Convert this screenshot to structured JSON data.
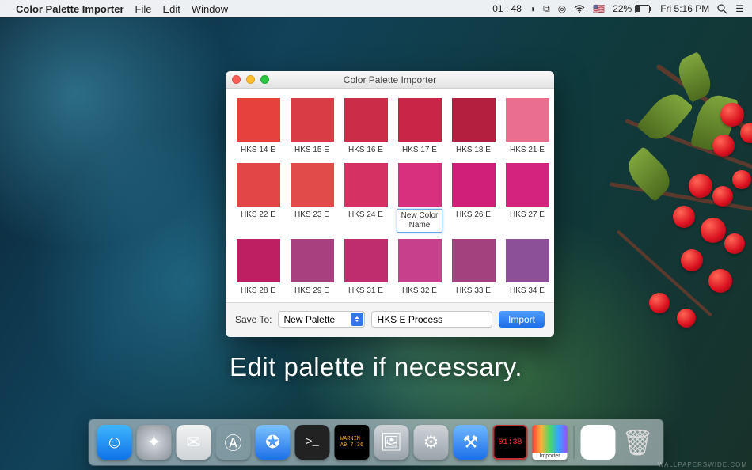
{
  "menubar": {
    "app_name": "Color Palette Importer",
    "items": [
      "File",
      "Edit",
      "Window"
    ],
    "clock_left": "01 : 48",
    "battery_pct": "22%",
    "clock_right": "Fri 5:16 PM"
  },
  "window": {
    "title": "Color Palette Importer",
    "swatches": [
      {
        "label": "HKS 14 E",
        "color": "#e7413d",
        "editing": false
      },
      {
        "label": "HKS 15 E",
        "color": "#d93c44",
        "editing": false
      },
      {
        "label": "HKS 16 E",
        "color": "#cb2c47",
        "editing": false
      },
      {
        "label": "HKS 17 E",
        "color": "#c92546",
        "editing": false
      },
      {
        "label": "HKS 18 E",
        "color": "#b41f3f",
        "editing": false
      },
      {
        "label": "HKS 21 E",
        "color": "#ea6f8e",
        "editing": false
      },
      {
        "label": "HKS 22 E",
        "color": "#e24646",
        "editing": false
      },
      {
        "label": "HKS 23 E",
        "color": "#e14b4a",
        "editing": false
      },
      {
        "label": "HKS 24 E",
        "color": "#d63163",
        "editing": false
      },
      {
        "label": "New Color Name",
        "color": "#d82f7e",
        "editing": true
      },
      {
        "label": "HKS 26 E",
        "color": "#cf1f79",
        "editing": false
      },
      {
        "label": "HKS 27 E",
        "color": "#d4237f",
        "editing": false
      },
      {
        "label": "HKS 28 E",
        "color": "#be1f62",
        "editing": false
      },
      {
        "label": "HKS 29 E",
        "color": "#a8407e",
        "editing": false
      },
      {
        "label": "HKS 31 E",
        "color": "#c02d6f",
        "editing": false
      },
      {
        "label": "HKS 32 E",
        "color": "#c7408b",
        "editing": false
      },
      {
        "label": "HKS 33 E",
        "color": "#a3417f",
        "editing": false
      },
      {
        "label": "HKS 34 E",
        "color": "#8c5099",
        "editing": false
      }
    ],
    "save_to_label": "Save To:",
    "save_to_value": "New Palette",
    "palette_name": "HKS E Process",
    "import_label": "Import"
  },
  "caption": "Edit palette if necessary.",
  "dock": {
    "items": [
      {
        "name": "finder",
        "bg": "linear-gradient(#3fb6ff,#1072e8)",
        "glyph": "☺"
      },
      {
        "name": "launchpad",
        "bg": "radial-gradient(circle,#d8dde2,#8a9198)",
        "glyph": "✦"
      },
      {
        "name": "mail",
        "bg": "linear-gradient(#f2f2f2,#cfd4d8)",
        "glyph": "✉"
      },
      {
        "name": "appstore",
        "bg": "linear-gradient(#5ac7ff,#177e8)",
        "glyph": "Ⓐ"
      },
      {
        "name": "safari",
        "bg": "linear-gradient(#7cc2ff,#1d6fe8)",
        "glyph": "✪"
      },
      {
        "name": "terminal",
        "bg": "#222",
        "glyph": ">_"
      },
      {
        "name": "console",
        "bg": "#000",
        "glyph": "WARNING"
      },
      {
        "name": "preview",
        "bg": "linear-gradient(#cfd4d8,#9aa3ab)",
        "glyph": "🖼"
      },
      {
        "name": "automator",
        "bg": "linear-gradient(#cfd4d8,#9aa3ab)",
        "glyph": "⚙"
      },
      {
        "name": "xcode",
        "bg": "linear-gradient(#6fb8ff,#1d6fe8)",
        "glyph": "⚒"
      },
      {
        "name": "clock",
        "bg": "#000",
        "glyph": "01:38"
      },
      {
        "name": "importer",
        "bg": "linear-gradient(90deg,#ff3b3b,#ffb03b,#4bd964,#34a4ff,#9950ff)",
        "glyph": "Importer"
      },
      {
        "name": "sep",
        "bg": "",
        "glyph": ""
      },
      {
        "name": "appbox",
        "bg": "#fff",
        "glyph": "□"
      },
      {
        "name": "trash",
        "bg": "transparent",
        "glyph": "🗑"
      }
    ]
  },
  "watermark": "WALLPAPERSWIDE.COM"
}
